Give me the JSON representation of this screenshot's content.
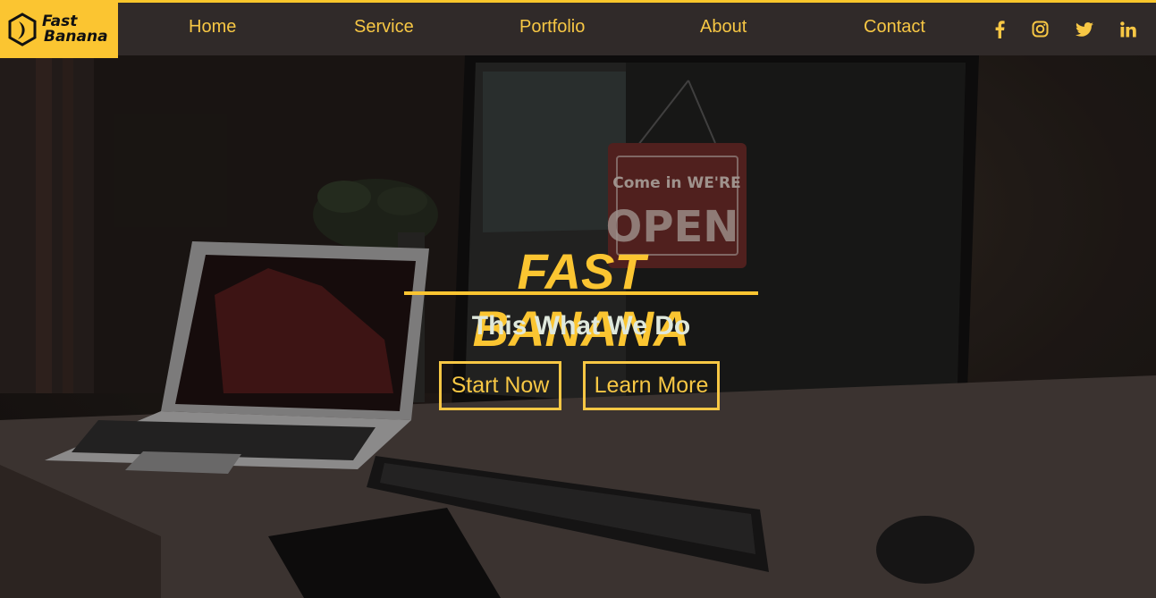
{
  "brand": {
    "line1": "Fast",
    "line2": "Banana"
  },
  "nav": {
    "items": [
      {
        "label": "Home"
      },
      {
        "label": "Service"
      },
      {
        "label": "Portfolio"
      },
      {
        "label": "About"
      },
      {
        "label": "Contact"
      }
    ]
  },
  "social": [
    {
      "icon": "facebook-icon"
    },
    {
      "icon": "instagram-icon"
    },
    {
      "icon": "twitter-icon"
    },
    {
      "icon": "linkedin-icon"
    }
  ],
  "hero": {
    "title": "FAST BANANA",
    "subtitle": "This What We Do",
    "buttons": {
      "start": "Start Now",
      "learn": "Learn More"
    },
    "sign_top": "Come in WE'RE",
    "sign_bottom": "OPEN"
  },
  "colors": {
    "accent": "#fbc531",
    "header_bg": "#302a29",
    "subtitle": "#dfe8dc"
  }
}
